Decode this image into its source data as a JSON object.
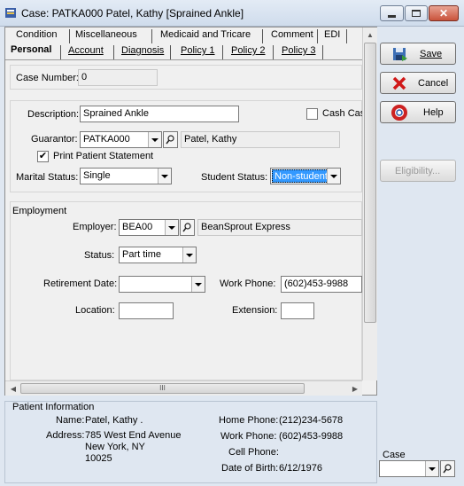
{
  "window": {
    "title": "Case: PATKA000 Patel, Kathy  [Sprained Ankle]"
  },
  "tabs": {
    "row1": [
      "Condition",
      "Miscellaneous",
      "Medicaid and Tricare",
      "Comment",
      "EDI"
    ],
    "row2": [
      "Personal",
      "Account",
      "Diagnosis",
      "Policy 1",
      "Policy 2",
      "Policy 3"
    ]
  },
  "case": {
    "label": "Case Number:",
    "value": "0"
  },
  "description": {
    "label": "Description:",
    "value": "Sprained Ankle"
  },
  "cash_case": {
    "label": "Cash Cas",
    "checked": false
  },
  "guarantor": {
    "label": "Guarantor:",
    "code": "PATKA000",
    "name": "Patel, Kathy"
  },
  "print_statement": {
    "label": "Print Patient Statement",
    "checked": true
  },
  "marital": {
    "label": "Marital Status:",
    "value": "Single"
  },
  "student": {
    "label": "Student Status:",
    "value": "Non-student"
  },
  "employment": {
    "heading": "Employment",
    "employer_label": "Employer:",
    "employer_code": "BEA00",
    "employer_name": "BeanSprout Express",
    "status_label": "Status:",
    "status_value": "Part time",
    "retirement_label": "Retirement Date:",
    "retirement_value": "",
    "work_phone_label": "Work Phone:",
    "work_phone_value": "(602)453-9988",
    "location_label": "Location:",
    "location_value": "",
    "extension_label": "Extension:",
    "extension_value": ""
  },
  "hscroll": {
    "grip": "III"
  },
  "buttons": {
    "save": "Save",
    "cancel": "Cancel",
    "help": "Help",
    "eligibility": "Eligibility..."
  },
  "patient_info": {
    "heading": "Patient Information",
    "name_label": "Name:",
    "name_value": "Patel, Kathy .",
    "address_label": "Address:",
    "address_line1": "785 West End Avenue",
    "address_line2": "New York, NY",
    "address_line3": "10025",
    "home_phone_label": "Home Phone:",
    "home_phone_value": "(212)234-5678",
    "work_phone_label": "Work Phone:",
    "work_phone_value": "(602)453-9988",
    "cell_phone_label": "Cell Phone:",
    "cell_phone_value": "",
    "dob_label": "Date of Birth:",
    "dob_value": "6/12/1976"
  },
  "case_lookup": {
    "label": "Case",
    "value": ""
  },
  "colors": {
    "title_bg": "#dfe7f1",
    "panel_bg": "#f0f0f0",
    "selection": "#3399ff",
    "close": "#c9533b"
  }
}
